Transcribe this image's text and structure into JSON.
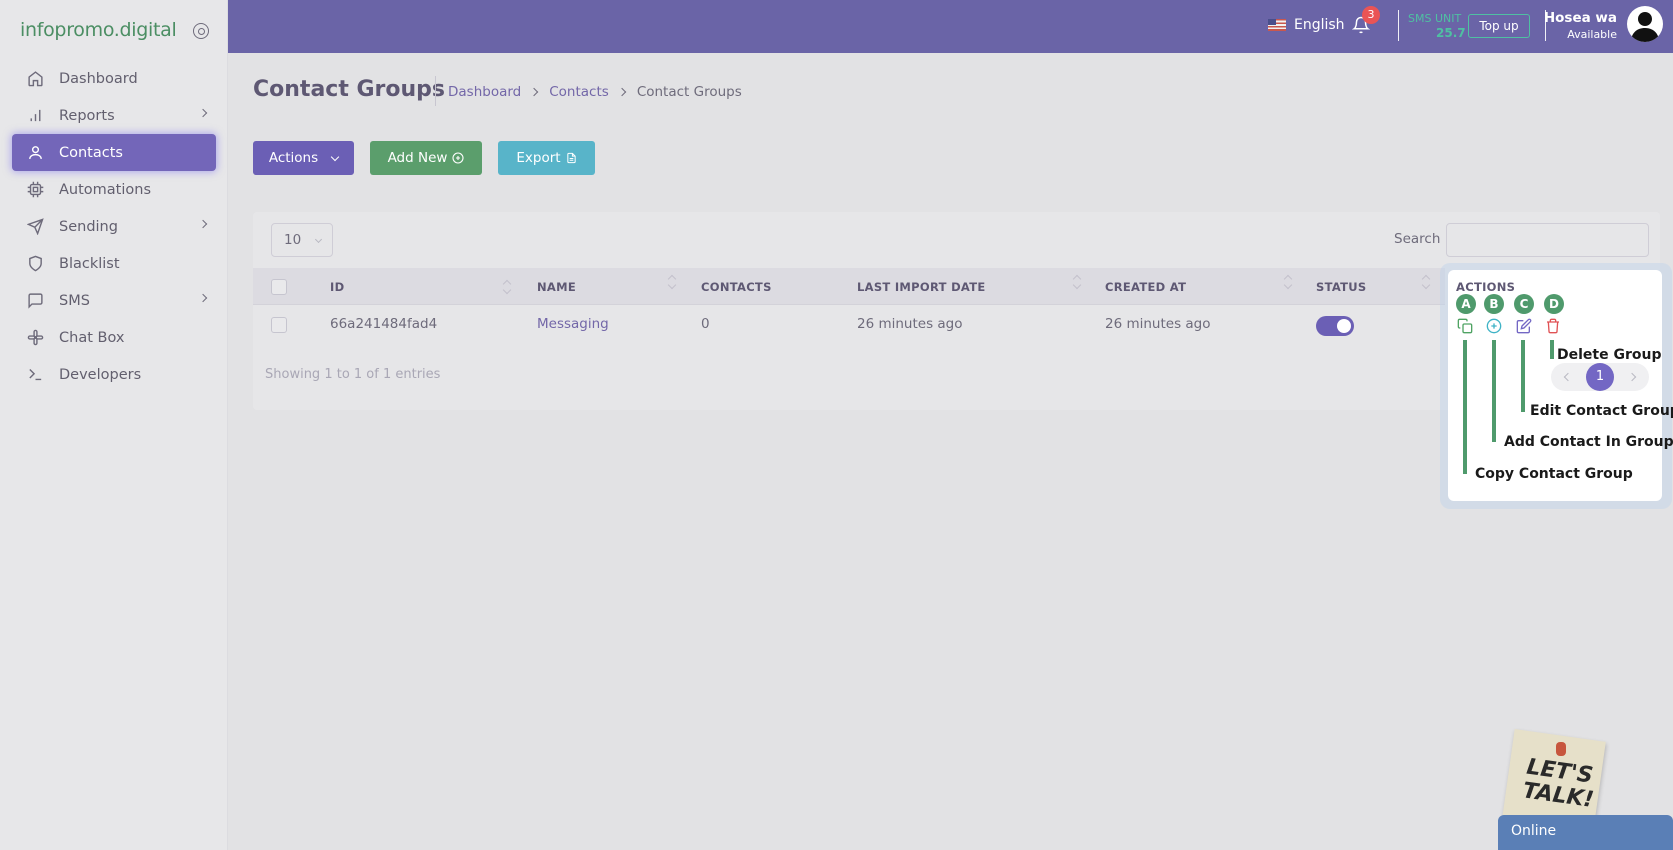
{
  "brand": {
    "name": "infopromo.digital"
  },
  "sidebar": {
    "items": [
      {
        "label": "Dashboard",
        "icon": "home-icon",
        "has_children": false
      },
      {
        "label": "Reports",
        "icon": "bar-chart-icon",
        "has_children": true
      },
      {
        "label": "Contacts",
        "icon": "user-icon",
        "has_children": false,
        "active": true
      },
      {
        "label": "Automations",
        "icon": "cpu-icon",
        "has_children": false
      },
      {
        "label": "Sending",
        "icon": "send-icon",
        "has_children": true
      },
      {
        "label": "Blacklist",
        "icon": "shield-icon",
        "has_children": false
      },
      {
        "label": "SMS",
        "icon": "message-square-icon",
        "has_children": true
      },
      {
        "label": "Chat Box",
        "icon": "slack-icon",
        "has_children": false
      },
      {
        "label": "Developers",
        "icon": "terminal-icon",
        "has_children": false
      }
    ]
  },
  "topbar": {
    "language": "English",
    "notifications_count": "3",
    "sms_unit_label": "SMS UNIT",
    "sms_unit_value": "25.7",
    "topup_label": "Top up",
    "user_name": "Hosea wa",
    "user_status": "Available"
  },
  "page": {
    "title": "Contact Groups",
    "breadcrumb": [
      "Dashboard",
      "Contacts",
      "Contact Groups"
    ]
  },
  "toolbar": {
    "actions_label": "Actions",
    "add_label": "Add New",
    "export_label": "Export"
  },
  "table": {
    "page_length": "10",
    "search_label": "Search",
    "columns": [
      "ID",
      "NAME",
      "CONTACTS",
      "LAST IMPORT DATE",
      "CREATED AT",
      "STATUS",
      "ACTIONS"
    ],
    "rows": [
      {
        "id": "66a241484fad4",
        "name": "Messaging",
        "contacts": "0",
        "last_import": "26 minutes ago",
        "created_at": "26 minutes ago",
        "status_on": true
      }
    ],
    "info": "Showing 1 to 1 of 1 entries",
    "current_page": "1"
  },
  "annotations": {
    "markers": [
      "A",
      "B",
      "C",
      "D"
    ],
    "labels": {
      "copy": "Copy Contact Group",
      "add": "Add Contact In Group",
      "edit": "Edit Contact Group",
      "delete": "Delete Group"
    }
  },
  "chat_widget": {
    "sticky_text": "LET'S TALK!",
    "status": "Online"
  },
  "colors": {
    "topbar": "#6a64a7",
    "primary": "#6b5fb5",
    "success": "#5b9e6c",
    "info": "#58b4c9",
    "marker": "#4f9a6c"
  }
}
